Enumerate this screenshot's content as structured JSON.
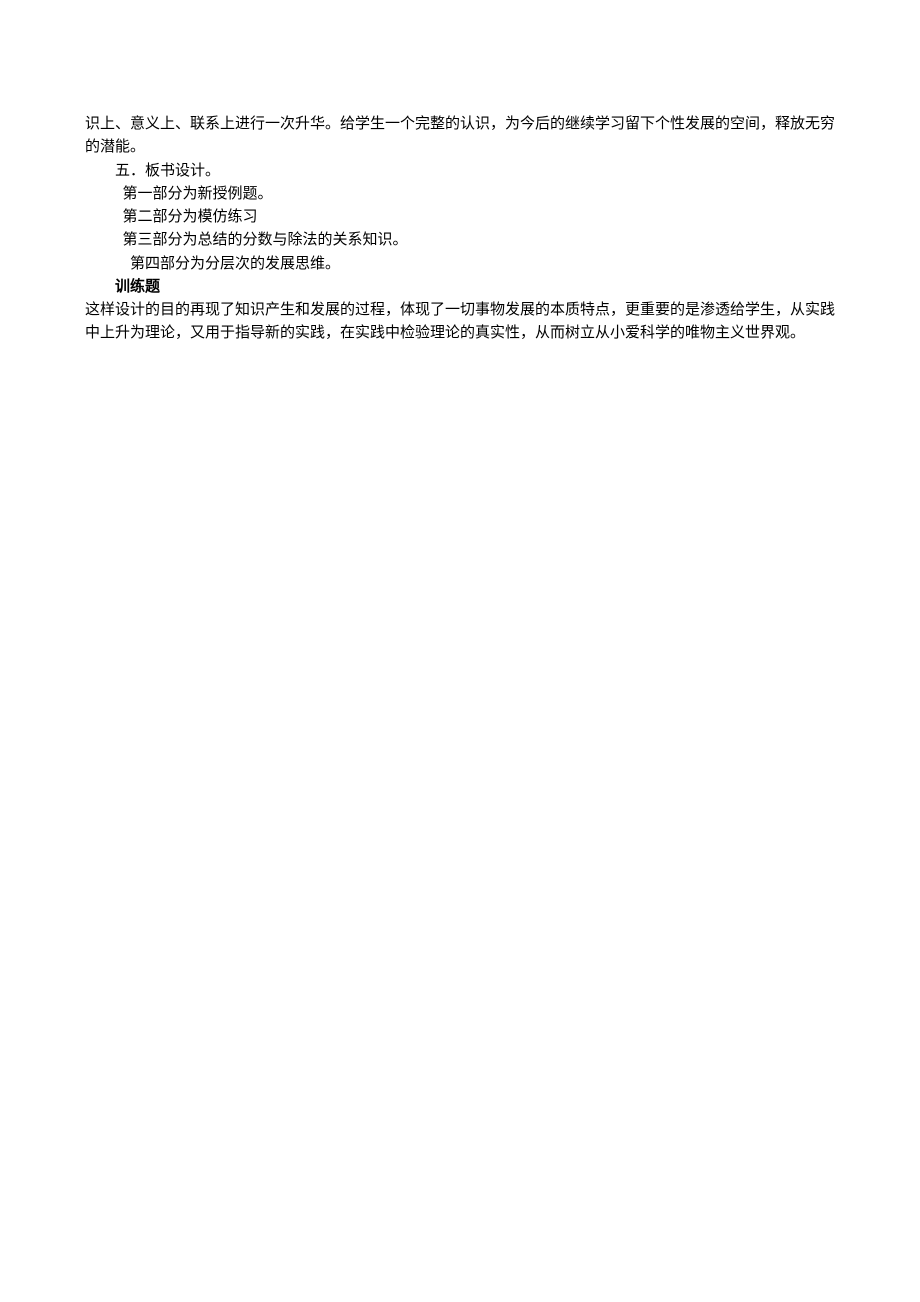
{
  "p1": "识上、意义上、联系上进行一次升华。给学生一个完整的认识，为今后的继续学习留下个性发展的空间，释放无穷的潜能。",
  "section_heading": "五．板书设计。",
  "part1": "第一部分为新授例题。",
  "part2": "第二部分为模仿练习",
  "part3": "第三部分为总结的分数与除法的关系知识。",
  "part4": "第四部分为分层次的发展思维。",
  "exercise_label": "训练题",
  "p2": "这样设计的目的再现了知识产生和发展的过程，体现了一切事物发展的本质特点，更重要的是渗透给学生，从实践中上升为理论，又用于指导新的实践，在实践中检验理论的真实性，从而树立从小爱科学的唯物主义世界观。"
}
